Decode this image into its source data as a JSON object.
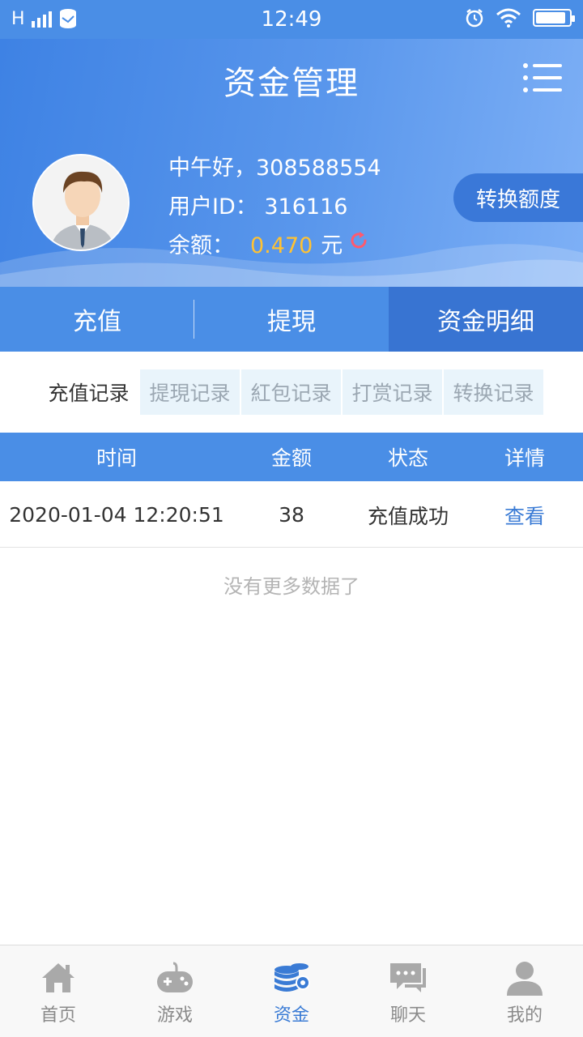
{
  "status_bar": {
    "time": "12:49",
    "network": "H",
    "battery_level": 0.9
  },
  "header": {
    "title": "资金管理"
  },
  "user": {
    "greeting": "中午好，308588554",
    "id_label": "用户ID：",
    "id_value": "316116",
    "balance_label": "余额：",
    "balance_value": "0.470",
    "balance_unit": "元"
  },
  "convert_button": "转换额度",
  "main_tabs": [
    {
      "label": "充值"
    },
    {
      "label": "提現"
    },
    {
      "label": "资金明细"
    }
  ],
  "sub_tabs": [
    {
      "label": "充值记录"
    },
    {
      "label": "提現记录"
    },
    {
      "label": "紅包记录"
    },
    {
      "label": "打赏记录"
    },
    {
      "label": "转换记录"
    }
  ],
  "table": {
    "headers": [
      "时间",
      "金额",
      "状态",
      "详情"
    ],
    "rows": [
      {
        "time": "2020-01-04 12:20:51",
        "amount": "38",
        "status": "充值成功",
        "detail": "查看"
      }
    ],
    "empty_note": "没有更多数据了"
  },
  "bottom_nav": [
    {
      "label": "首页",
      "icon": "home-icon"
    },
    {
      "label": "游戏",
      "icon": "gamepad-icon"
    },
    {
      "label": "资金",
      "icon": "coins-gear-icon"
    },
    {
      "label": "聊天",
      "icon": "chat-icon"
    },
    {
      "label": "我的",
      "icon": "user-icon"
    }
  ],
  "colors": {
    "primary": "#4a8ee6",
    "active_tab": "#3874d2",
    "balance": "#ffc233",
    "link": "#3a7bd5",
    "refresh": "#ff5a6e"
  }
}
